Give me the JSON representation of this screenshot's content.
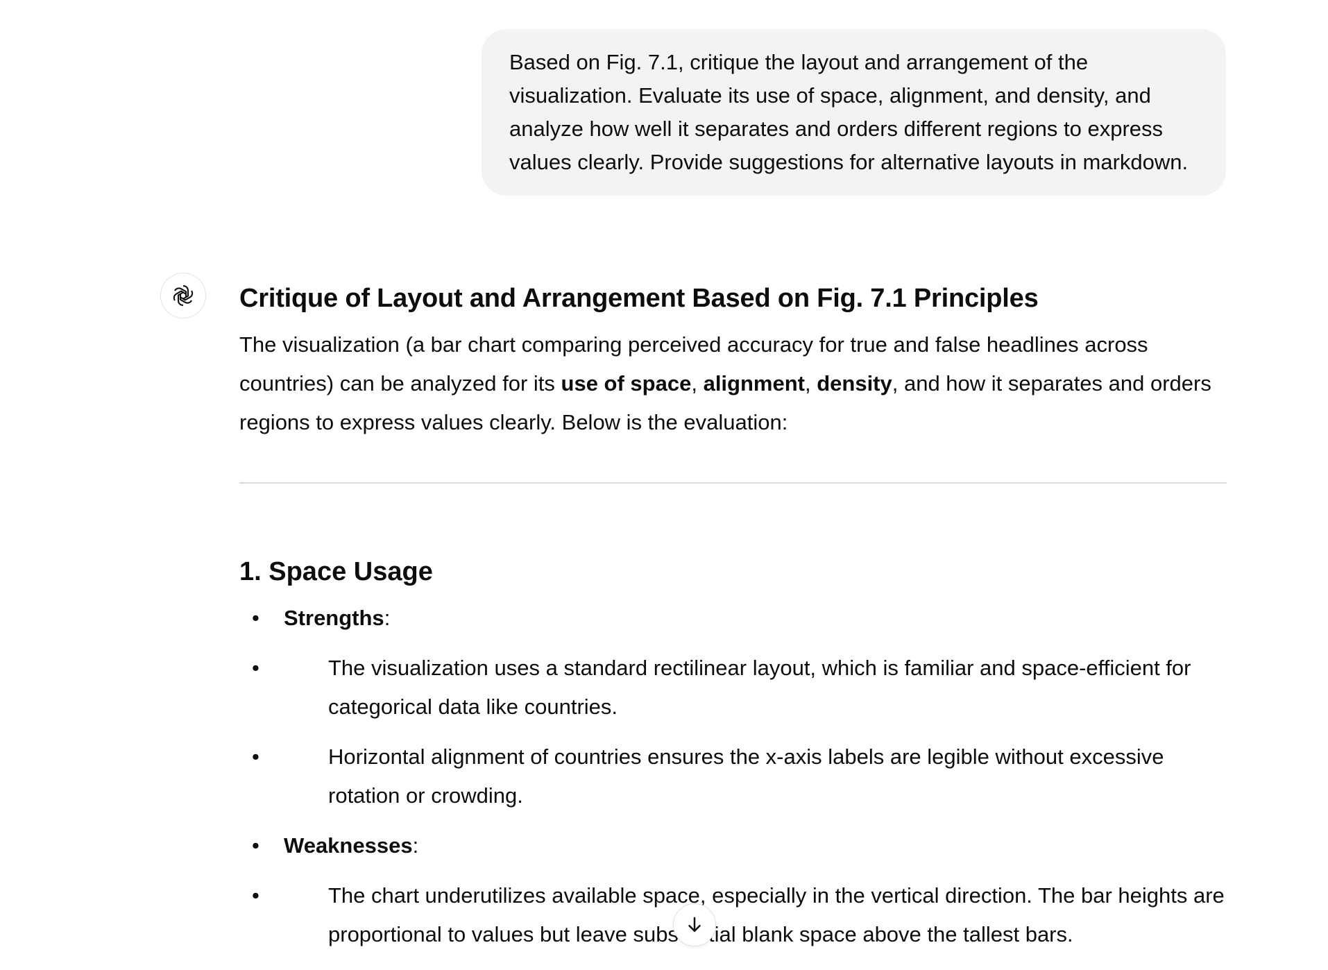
{
  "user_message": {
    "text": "Based on Fig. 7.1, critique the layout and arrangement of the visualization. Evaluate its use of space, alignment, and density, and analyze how well it separates and orders different regions to express values clearly. Provide suggestions for alternative layouts in markdown."
  },
  "assistant": {
    "avatar_icon": "openai-logo-icon",
    "heading": "Critique of Layout and Arrangement Based on Fig. 7.1 Principles",
    "intro": {
      "part1": "The visualization (a bar chart comparing perceived accuracy for true and false headlines across countries) can be analyzed for its ",
      "bold1": "use of space",
      "sep1": ", ",
      "bold2": "alignment",
      "sep2": ", ",
      "bold3": "density",
      "part2": ", and how it separates and orders regions to express values clearly. Below is the evaluation:"
    },
    "section1": {
      "title": "1. Space Usage",
      "strengths_label": "Strengths",
      "colon": ":",
      "strengths": [
        "The visualization uses a standard rectilinear layout, which is familiar and space-efficient for categorical data like countries.",
        "Horizontal alignment of countries ensures the x-axis labels are legible without excessive rotation or crowding."
      ],
      "weaknesses_label": "Weaknesses",
      "weaknesses": [
        "The chart underutilizes available space, especially in the vertical direction. The bar heights are proportional to values but leave substantial blank space above the tallest bars."
      ]
    }
  },
  "scroll_button": {
    "icon": "arrow-down-icon"
  }
}
